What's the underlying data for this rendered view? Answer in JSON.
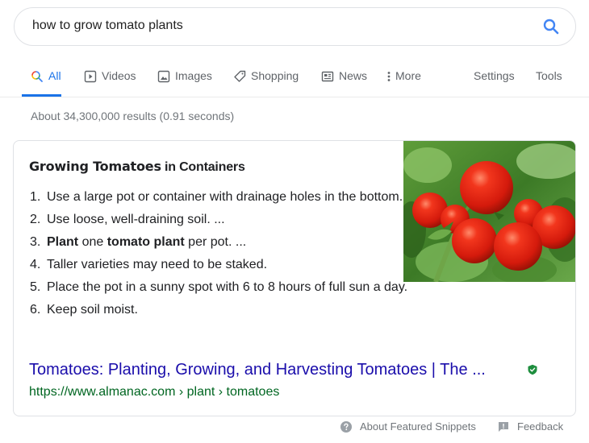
{
  "search": {
    "query": "how to grow tomato plants",
    "search_icon": "search-icon"
  },
  "tabs": [
    {
      "label": "All",
      "icon": "search-color-icon",
      "active": true
    },
    {
      "label": "Videos",
      "icon": "video-play-icon",
      "active": false
    },
    {
      "label": "Images",
      "icon": "image-icon",
      "active": false
    },
    {
      "label": "Shopping",
      "icon": "tag-icon",
      "active": false
    },
    {
      "label": "News",
      "icon": "newspaper-icon",
      "active": false
    },
    {
      "label": "More",
      "icon": "more-vertical-icon",
      "active": false
    }
  ],
  "tools": {
    "settings_label": "Settings",
    "tools_label": "Tools"
  },
  "result_stats": "About 34,300,000 results (0.91 seconds)",
  "featured_snippet": {
    "title_bold": "Growing Tomatoes",
    "title_rest": " in Containers",
    "steps": [
      {
        "num": "1.",
        "text": "Use a large pot or container with drainage holes in the bottom."
      },
      {
        "num": "2.",
        "text": "Use loose, well-draining soil. ..."
      },
      {
        "num": "3.",
        "parts": [
          {
            "text": "Plant",
            "bold": true
          },
          {
            "text": " one ",
            "bold": false
          },
          {
            "text": "tomato plant",
            "bold": true
          },
          {
            "text": " per pot. ...",
            "bold": false
          }
        ]
      },
      {
        "num": "4.",
        "text": "Taller varieties may need to be staked."
      },
      {
        "num": "5.",
        "text": "Place the pot in a sunny spot with 6 to 8 hours of full sun a day."
      },
      {
        "num": "6.",
        "text": "Keep soil moist."
      }
    ],
    "image_alt": "Red tomatoes on the vine",
    "link_title": "Tomatoes: Planting, Growing, and Harvesting Tomatoes | The ...",
    "verified_icon": "verified-shield-icon",
    "url": "https://www.almanac.com › plant › tomatoes",
    "colors": {
      "link": "#1a0dab",
      "url": "#006621",
      "verified": "#1e8e3e"
    }
  },
  "footer": {
    "about_label": "About Featured Snippets",
    "feedback_label": "Feedback"
  },
  "accent_color": "#1a73e8"
}
